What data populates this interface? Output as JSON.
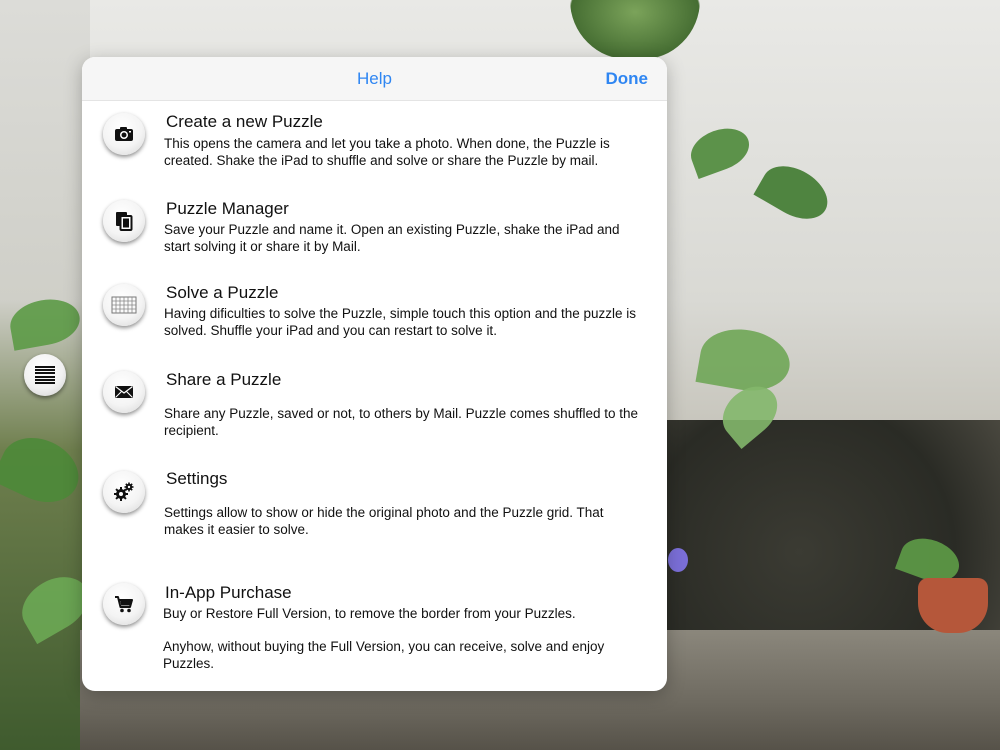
{
  "header": {
    "title": "Help",
    "done_label": "Done"
  },
  "items": [
    {
      "icon": "camera-icon",
      "title": "Create a new Puzzle",
      "description": "This opens the camera and let you take a photo. When done, the Puzzle is created. Shake the iPad to shuffle and solve or share the Puzzle by mail."
    },
    {
      "icon": "copy-documents-icon",
      "title": "Puzzle Manager",
      "description": "Save your Puzzle and name it. Open an existing Puzzle, shake the iPad and start solving it or share it by Mail."
    },
    {
      "icon": "puzzle-grid-icon",
      "title": "Solve a Puzzle",
      "description": "Having dificulties to solve the Puzzle, simple touch this option and the puzzle is solved. Shuffle your iPad and you can restart to solve it."
    },
    {
      "icon": "envelope-icon",
      "title": "Share a Puzzle",
      "description": "Share any Puzzle, saved or not, to others by Mail. Puzzle comes shuffled to the recipient."
    },
    {
      "icon": "gears-icon",
      "title": "Settings",
      "description": "Settings allow to show or hide the original photo and the Puzzle grid. That makes it easier to solve."
    },
    {
      "icon": "shopping-cart-icon",
      "title": "In-App Purchase",
      "description": "Buy or Restore Full Version, to remove the border from your Puzzles.",
      "description2": "Anyhow, without buying the Full Version, you can receive, solve and enjoy Puzzles."
    }
  ],
  "floating_button": {
    "icon": "menu-lines-icon"
  }
}
